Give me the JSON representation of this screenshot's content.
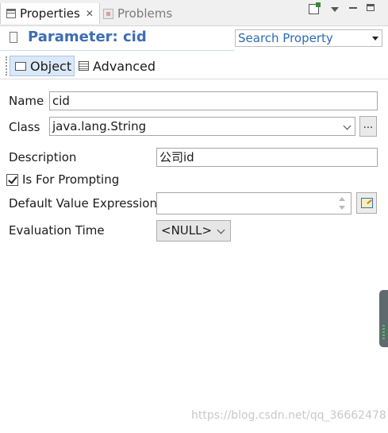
{
  "tabs": [
    {
      "label": "Properties",
      "active": true,
      "icon": "properties-icon"
    },
    {
      "label": "Problems",
      "active": false,
      "icon": "problems-icon"
    }
  ],
  "header": {
    "title": "Parameter: cid",
    "search_label": "Search Property"
  },
  "subtabs": [
    {
      "label": "Object",
      "active": true,
      "icon": "object-icon"
    },
    {
      "label": "Advanced",
      "active": false,
      "icon": "advanced-icon"
    }
  ],
  "form": {
    "name_label": "Name",
    "name_value": "cid",
    "class_label": "Class",
    "class_value": "java.lang.String",
    "class_browse_label": "...",
    "description_label": "Description",
    "description_value": "公司id",
    "prompting_label": "Is For Prompting",
    "prompting_checked": true,
    "default_expr_label": "Default Value Expression",
    "default_expr_value": "",
    "eval_time_label": "Evaluation Time",
    "eval_time_value": "<NULL>"
  },
  "watermark": "https://blog.csdn.net/qq_36662478",
  "colors": {
    "accent": "#3c6db2",
    "selected_tab": "#dbe8f7"
  }
}
